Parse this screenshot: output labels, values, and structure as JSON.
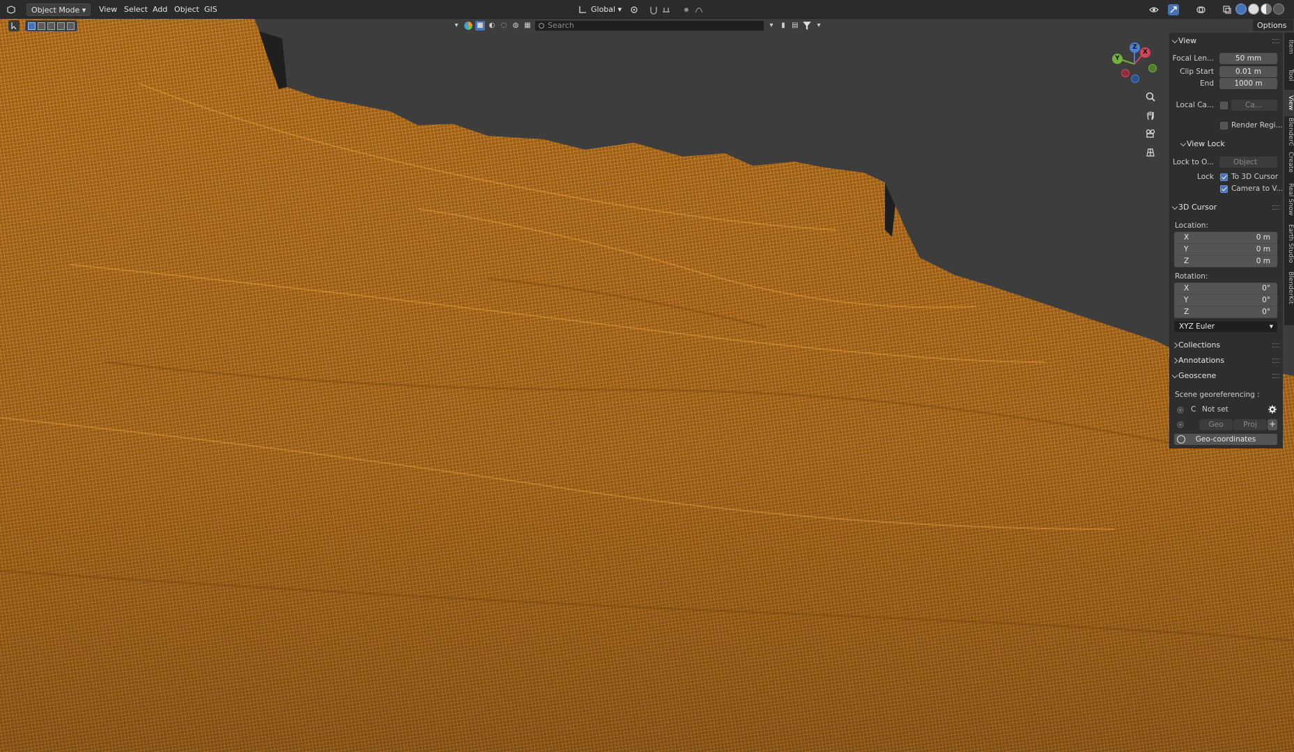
{
  "header": {
    "mode_label": "Object Mode",
    "menus": [
      "View",
      "Select",
      "Add",
      "Object",
      "GIS"
    ],
    "orientation_label": "Global",
    "options_label": "Options"
  },
  "filter": {
    "search_placeholder": "Search"
  },
  "gizmo": {
    "z": "Z",
    "y": "Y",
    "x": "X"
  },
  "npanel": {
    "view": {
      "title": "View",
      "focal_label": "Focal Len...",
      "focal_value": "50 mm",
      "clip_start_label": "Clip Start",
      "clip_start_value": "0.01 m",
      "clip_end_label": "End",
      "clip_end_value": "1000 m",
      "local_cam_label": "Local Ca...",
      "local_cam_value": "Ca...",
      "render_region_label": "Render Regi..."
    },
    "view_lock": {
      "title": "View Lock",
      "lock_to_label": "Lock to O...",
      "lock_to_placeholder": "Object",
      "lock_label": "Lock",
      "to_cursor_label": "To 3D Cursor",
      "camera_to_view_label": "Camera to V..."
    },
    "cursor": {
      "title": "3D Cursor",
      "location_label": "Location:",
      "loc": [
        {
          "axis": "X",
          "value": "0 m"
        },
        {
          "axis": "Y",
          "value": "0 m"
        },
        {
          "axis": "Z",
          "value": "0 m"
        }
      ],
      "rotation_label": "Rotation:",
      "rot": [
        {
          "axis": "X",
          "value": "0°"
        },
        {
          "axis": "Y",
          "value": "0°"
        },
        {
          "axis": "Z",
          "value": "0°"
        }
      ],
      "rotation_mode": "XYZ Euler"
    },
    "collections_title": "Collections",
    "annotations_title": "Annotations",
    "geoscene": {
      "title": "Geoscene",
      "georef_label": "Scene georeferencing :",
      "crs_letter": "C",
      "not_set": "Not set",
      "geo_label": "Geo",
      "proj_label": "Proj",
      "geocoords_button": "Geo-coordinates"
    }
  },
  "vtabs": [
    "Item",
    "Tool",
    "View",
    "BlenderGIS",
    "Create",
    "Real Snow",
    "Earth Studio",
    "BlenderKit"
  ],
  "colors": {
    "wire": "#e8982c",
    "viewport_bg": "#3d3d3d",
    "accent": "#4772b3"
  }
}
